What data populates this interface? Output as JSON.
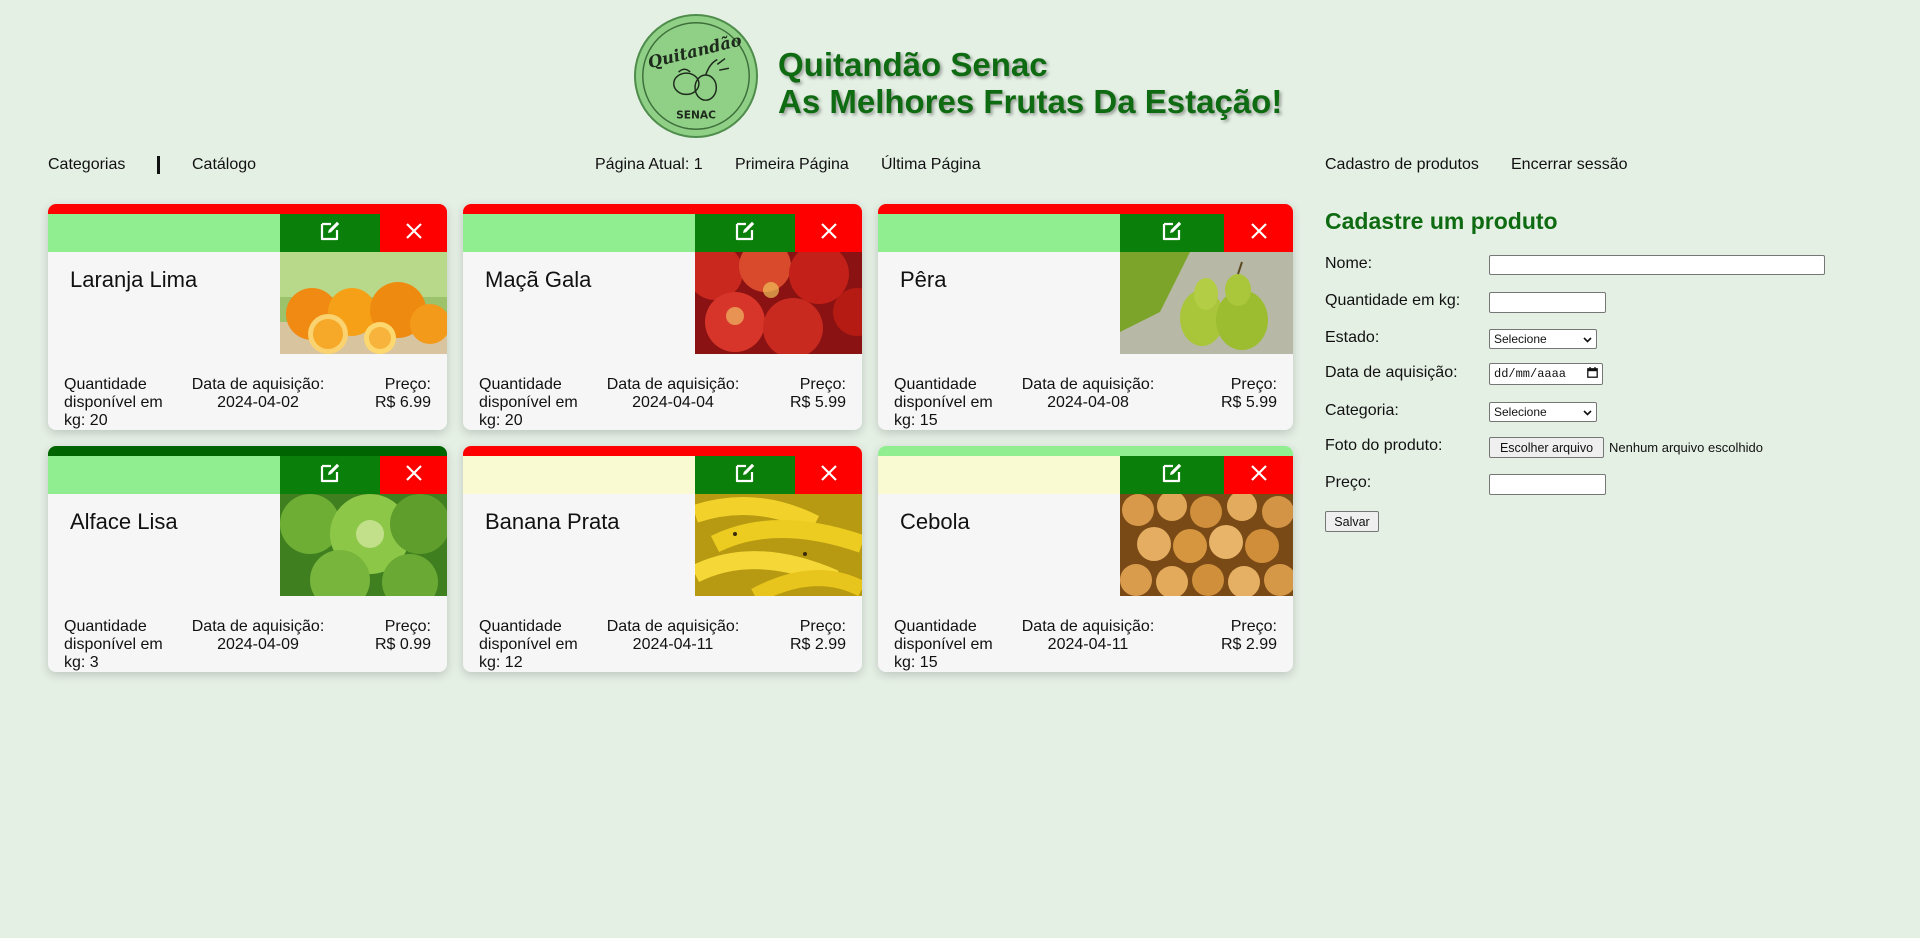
{
  "header": {
    "logo_text_top": "Quitandão",
    "logo_text_bottom": "SENAC",
    "title_line1": "Quitandão Senac",
    "title_line2": "As Melhores Frutas Da Estação!",
    "title_color": "#0f6b12"
  },
  "nav": {
    "categorias": "Categorias",
    "catalogo": "Catálogo",
    "pagina_atual": "Página Atual: 1",
    "primeira": "Primeira Página",
    "ultima": "Última Página",
    "cadastro": "Cadastro de produtos",
    "encerrar": "Encerrar sessão"
  },
  "products": [
    {
      "name": "Laranja Lima",
      "qty": "Quantidade disponível em kg: 20",
      "date_label": "Data de aquisição:",
      "date": "2024-04-02",
      "price_label": "Preço:",
      "price": "R$ 6.99",
      "top_color": "#ff0000",
      "bar_color": "#90ee90",
      "photo": "oranges-photo"
    },
    {
      "name": "Maçã Gala",
      "qty": "Quantidade disponível em kg: 20",
      "date_label": "Data de aquisição:",
      "date": "2024-04-04",
      "price_label": "Preço:",
      "price": "R$ 5.99",
      "top_color": "#ff0000",
      "bar_color": "#90ee90",
      "photo": "apples-photo"
    },
    {
      "name": "Pêra",
      "qty": "Quantidade disponível em kg: 15",
      "date_label": "Data de aquisição:",
      "date": "2024-04-08",
      "price_label": "Preço:",
      "price": "R$ 5.99",
      "top_color": "#ff0000",
      "bar_color": "#90ee90",
      "photo": "pears-photo"
    },
    {
      "name": "Alface Lisa",
      "qty": "Quantidade disponível em kg: 3",
      "date_label": "Data de aquisição:",
      "date": "2024-04-09",
      "price_label": "Preço:",
      "price": "R$ 0.99",
      "top_color": "#006400",
      "bar_color": "#90ee90",
      "photo": "lettuce-photo"
    },
    {
      "name": "Banana Prata",
      "qty": "Quantidade disponível em kg: 12",
      "date_label": "Data de aquisição:",
      "date": "2024-04-11",
      "price_label": "Preço:",
      "price": "R$ 2.99",
      "top_color": "#ff0000",
      "bar_color": "#fafad2",
      "photo": "bananas-photo"
    },
    {
      "name": "Cebola",
      "qty": "Quantidade disponível em kg: 15",
      "date_label": "Data de aquisição:",
      "date": "2024-04-11",
      "price_label": "Preço:",
      "price": "R$ 2.99",
      "top_color": "#90ee90",
      "bar_color": "#fafad2",
      "photo": "onions-photo"
    }
  ],
  "form": {
    "title": "Cadastre um produto",
    "nome_label": "Nome:",
    "qtd_label": "Quantidade em kg:",
    "estado_label": "Estado:",
    "estado_value": "Selecione",
    "data_label": "Data de aquisição:",
    "data_placeholder": "dd/mm/aaaa",
    "categoria_label": "Categoria:",
    "categoria_value": "Selecione",
    "foto_label": "Foto do produto:",
    "foto_button": "Escolher arquivo",
    "foto_status": "Nenhum arquivo escolhido",
    "preco_label": "Preço:",
    "salvar": "Salvar"
  },
  "colors": {
    "background": "#e5f0e5",
    "edit_button": "#0a7f0a",
    "delete_button": "#ff0000"
  }
}
